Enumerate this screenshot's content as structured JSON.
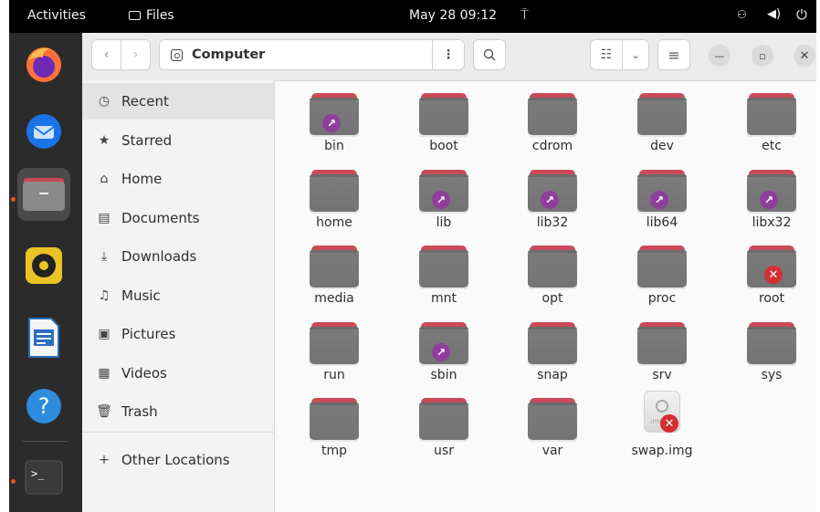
{
  "topbar": {
    "activities": "Activities",
    "app_name": "Files",
    "clock": "May 28  09:12"
  },
  "dock": {
    "items": [
      "firefox-icon",
      "thunderbird-icon",
      "files-icon",
      "rhythmbox-icon",
      "writer-icon",
      "help-icon",
      "terminal-icon"
    ]
  },
  "header": {
    "back": "‹",
    "forward": "›",
    "location": "Computer",
    "path_menu": "⋮",
    "search": "⌕",
    "view_list": "☷",
    "view_dropdown": "⌄",
    "main_menu": "≡",
    "minimize": "—",
    "maximize": "▫",
    "close": "✕"
  },
  "sidebar": {
    "items": [
      {
        "label": "Recent",
        "icon": "◷"
      },
      {
        "label": "Starred",
        "icon": "★"
      },
      {
        "label": "Home",
        "icon": "⌂"
      },
      {
        "label": "Documents",
        "icon": "▤"
      },
      {
        "label": "Downloads",
        "icon": "⤓"
      },
      {
        "label": "Music",
        "icon": "♫"
      },
      {
        "label": "Pictures",
        "icon": "▣"
      },
      {
        "label": "Videos",
        "icon": "▦"
      },
      {
        "label": "Trash",
        "icon": "🗑"
      }
    ],
    "other_locations": {
      "label": "Other Locations",
      "icon": "+"
    }
  },
  "files": [
    {
      "name": "bin",
      "emblem": "link"
    },
    {
      "name": "boot",
      "emblem": ""
    },
    {
      "name": "cdrom",
      "emblem": ""
    },
    {
      "name": "dev",
      "emblem": ""
    },
    {
      "name": "etc",
      "emblem": ""
    },
    {
      "name": "home",
      "emblem": ""
    },
    {
      "name": "lib",
      "emblem": "link"
    },
    {
      "name": "lib32",
      "emblem": "link"
    },
    {
      "name": "lib64",
      "emblem": "link"
    },
    {
      "name": "libx32",
      "emblem": "link"
    },
    {
      "name": "media",
      "emblem": ""
    },
    {
      "name": "mnt",
      "emblem": ""
    },
    {
      "name": "opt",
      "emblem": ""
    },
    {
      "name": "proc",
      "emblem": ""
    },
    {
      "name": "root",
      "emblem": "locked"
    },
    {
      "name": "run",
      "emblem": ""
    },
    {
      "name": "sbin",
      "emblem": "link"
    },
    {
      "name": "snap",
      "emblem": ""
    },
    {
      "name": "srv",
      "emblem": ""
    },
    {
      "name": "sys",
      "emblem": ""
    },
    {
      "name": "tmp",
      "emblem": ""
    },
    {
      "name": "usr",
      "emblem": ""
    },
    {
      "name": "var",
      "emblem": ""
    },
    {
      "name": "swap.img",
      "emblem": "locked",
      "type": "file"
    }
  ],
  "emblem_glyphs": {
    "link": "↗",
    "locked": "✕"
  },
  "colors": {
    "folder_tab": "#c94b58",
    "folder_body": "#7a7a7a",
    "link_emblem": "#8e3f9c",
    "locked_emblem": "#d42f35",
    "accent": "#e95420"
  }
}
